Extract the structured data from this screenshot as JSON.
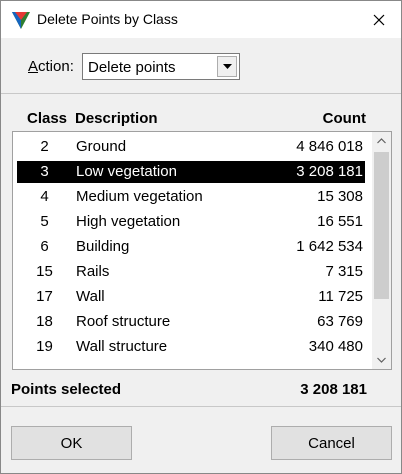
{
  "window": {
    "title": "Delete Points by Class",
    "icon": "triangle-app-icon",
    "close_icon": "close-icon"
  },
  "action": {
    "label_prefix": "A",
    "label_rest": "ction:",
    "selected": "Delete points"
  },
  "table": {
    "headers": {
      "class": "Class",
      "description": "Description",
      "count": "Count"
    },
    "rows": [
      {
        "class": "2",
        "description": "Ground",
        "count": "4 846 018",
        "selected": false
      },
      {
        "class": "3",
        "description": "Low vegetation",
        "count": "3 208 181",
        "selected": true
      },
      {
        "class": "4",
        "description": "Medium vegetation",
        "count": "15 308",
        "selected": false
      },
      {
        "class": "5",
        "description": "High vegetation",
        "count": "16 551",
        "selected": false
      },
      {
        "class": "6",
        "description": "Building",
        "count": "1 642 534",
        "selected": false
      },
      {
        "class": "15",
        "description": "Rails",
        "count": "7 315",
        "selected": false
      },
      {
        "class": "17",
        "description": "Wall",
        "count": "11 725",
        "selected": false
      },
      {
        "class": "18",
        "description": "Roof structure",
        "count": "63 769",
        "selected": false
      },
      {
        "class": "19",
        "description": "Wall structure",
        "count": "340 480",
        "selected": false
      }
    ]
  },
  "status": {
    "label": "Points selected",
    "value": "3 208 181"
  },
  "buttons": {
    "ok": "OK",
    "cancel": "Cancel"
  }
}
